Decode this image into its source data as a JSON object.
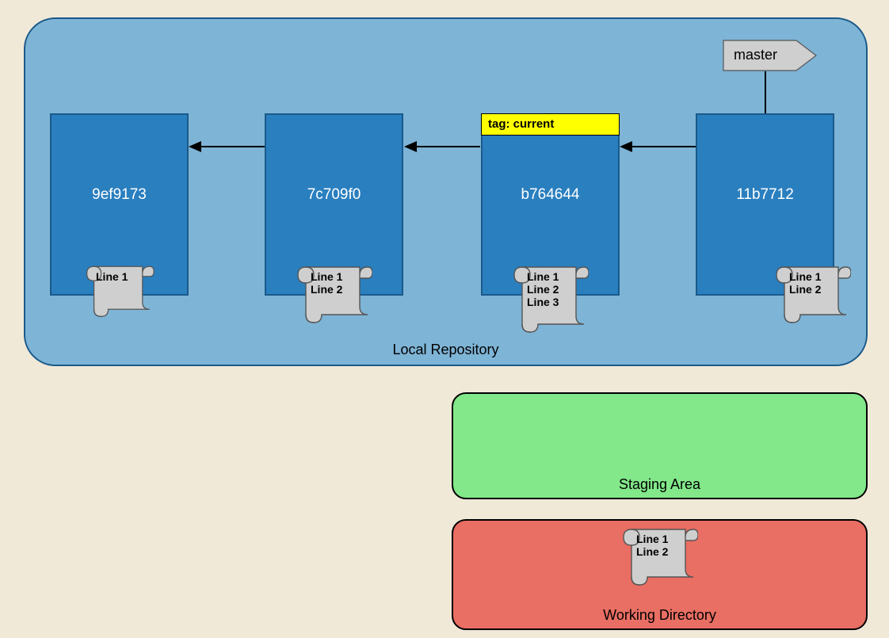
{
  "repo": {
    "label": "Local Repository"
  },
  "master": {
    "label": "master"
  },
  "commits": [
    {
      "hash": "9ef9173",
      "lines": "Line 1"
    },
    {
      "hash": "7c709f0",
      "lines": "Line 1\nLine 2"
    },
    {
      "hash": "b764644",
      "lines": "Line 1\nLine 2\nLine 3",
      "tag": "tag: current"
    },
    {
      "hash": "11b7712",
      "lines": "Line 1\nLine 2"
    }
  ],
  "staging": {
    "label": "Staging Area"
  },
  "working": {
    "label": "Working Directory",
    "lines": "Line 1\nLine 2"
  }
}
